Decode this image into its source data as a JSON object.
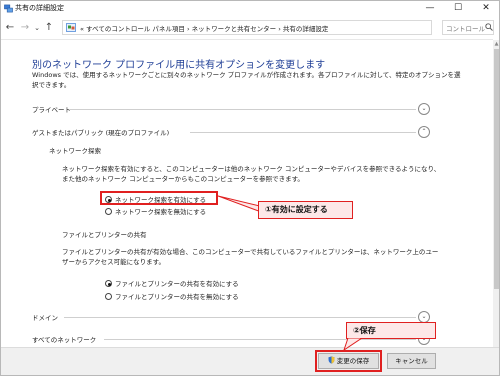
{
  "window": {
    "title": "共有の詳細設定",
    "minimize_glyph": "—",
    "maximize_glyph": "☐",
    "close_glyph": "✕"
  },
  "nav": {
    "back_glyph": "←",
    "forward_glyph": "→",
    "dropdown_glyph": "⌄",
    "up_glyph": "↑",
    "breadcrumbs": "« すべてのコントロール パネル項目 › ネットワークと共有センター › 共有の詳細設定",
    "search_placeholder": "コントロール"
  },
  "main": {
    "heading": "別のネットワーク プロファイル用に共有オプションを変更します",
    "description": "Windows では、使用するネットワークごとに別々のネットワーク プロファイルが作成されます。各プロファイルに対して、特定のオプションを選択できます。",
    "sections": {
      "private": {
        "label": "プライベート",
        "chevron": "⌄"
      },
      "guest": {
        "label": "ゲストまたはパブリック (現在のプロファイル)",
        "chevron": "⌃"
      },
      "domain": {
        "label": "ドメイン",
        "chevron": "⌄"
      },
      "all": {
        "label": "すべてのネットワーク",
        "chevron": "⌄"
      }
    },
    "network_discovery": {
      "title": "ネットワーク探索",
      "text": "ネットワーク探索を有効にすると、このコンピューターは他のネットワーク コンピューターやデバイスを参照できるようになり、また他のネットワーク コンピューターからもこのコンピューターを参照できます。",
      "options": [
        {
          "label": "ネットワーク探索を有効にする",
          "selected": true
        },
        {
          "label": "ネットワーク探索を無効にする",
          "selected": false
        }
      ]
    },
    "file_sharing": {
      "title": "ファイルとプリンターの共有",
      "text": "ファイルとプリンターの共有が有効な場合、このコンピューターで共有しているファイルとプリンターは、ネットワーク上のユーザーからアクセス可能になります。",
      "options": [
        {
          "label": "ファイルとプリンターの共有を有効にする",
          "selected": true
        },
        {
          "label": "ファイルとプリンターの共有を無効にする",
          "selected": false
        }
      ]
    }
  },
  "annotations": {
    "step1": "①有効に設定する",
    "step2": "②保存",
    "color": "#e02020"
  },
  "footer": {
    "save_label": "変更の保存",
    "cancel_label": "キャンセル"
  }
}
